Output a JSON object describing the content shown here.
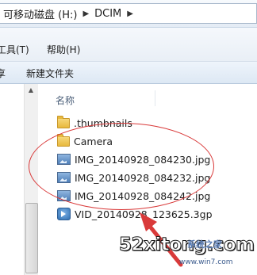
{
  "address": {
    "crumbs": [
      "可移动磁盘 (H:)",
      "DCIM"
    ]
  },
  "menubar": {
    "items": [
      {
        "label": "工具(T)"
      },
      {
        "label": "帮助(H)"
      }
    ]
  },
  "toolbar": {
    "new_folder_label": "新建文件夹",
    "left_fragment": "享"
  },
  "content": {
    "column_name": "名称",
    "files": [
      {
        "name": ".thumbnails",
        "icon": "folder-icon"
      },
      {
        "name": "Camera",
        "icon": "folder-icon"
      },
      {
        "name": "IMG_20140928_084230.jpg",
        "icon": "image-file-icon"
      },
      {
        "name": "IMG_20140928_084232.jpg",
        "icon": "image-file-icon"
      },
      {
        "name": "IMG_20140928_084242.jpg",
        "icon": "image-file-icon"
      },
      {
        "name": "VID_20140928_123625.3gp",
        "icon": "video-file-icon"
      }
    ]
  },
  "watermark": {
    "main": "52xitong.com",
    "sub": "系统之家",
    "url": "www.win7.com"
  },
  "colors": {
    "annotation": "#d93a3a",
    "header_text": "#4c607a"
  }
}
